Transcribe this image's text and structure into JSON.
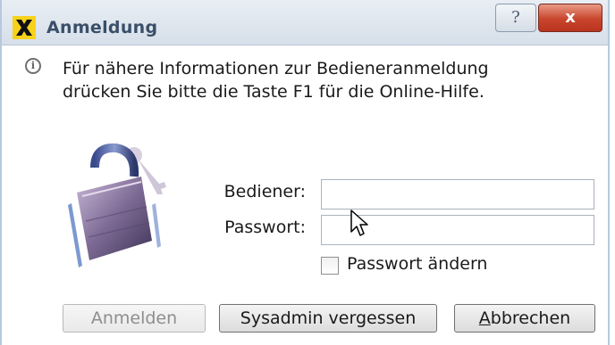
{
  "window": {
    "title": "Anmeldung",
    "help_label": "?",
    "close_label": "x"
  },
  "info": {
    "line1": "Für nähere Informationen zur Bedieneranmeldung",
    "line2": "drücken Sie bitte die Taste F1 für die Online-Hilfe."
  },
  "form": {
    "user_label": "Bediener:",
    "user_value": "",
    "password_label": "Passwort:",
    "password_value": "",
    "change_password_label": "Passwort ändern",
    "change_password_checked": false
  },
  "buttons": {
    "login": "Anmelden",
    "sysadmin": "Sysadmin vergessen",
    "cancel": "Abbrechen"
  },
  "colors": {
    "titlebar_text": "#3a4f69",
    "app_icon_bg": "#f7d21b",
    "close_button": "#c8452c"
  }
}
